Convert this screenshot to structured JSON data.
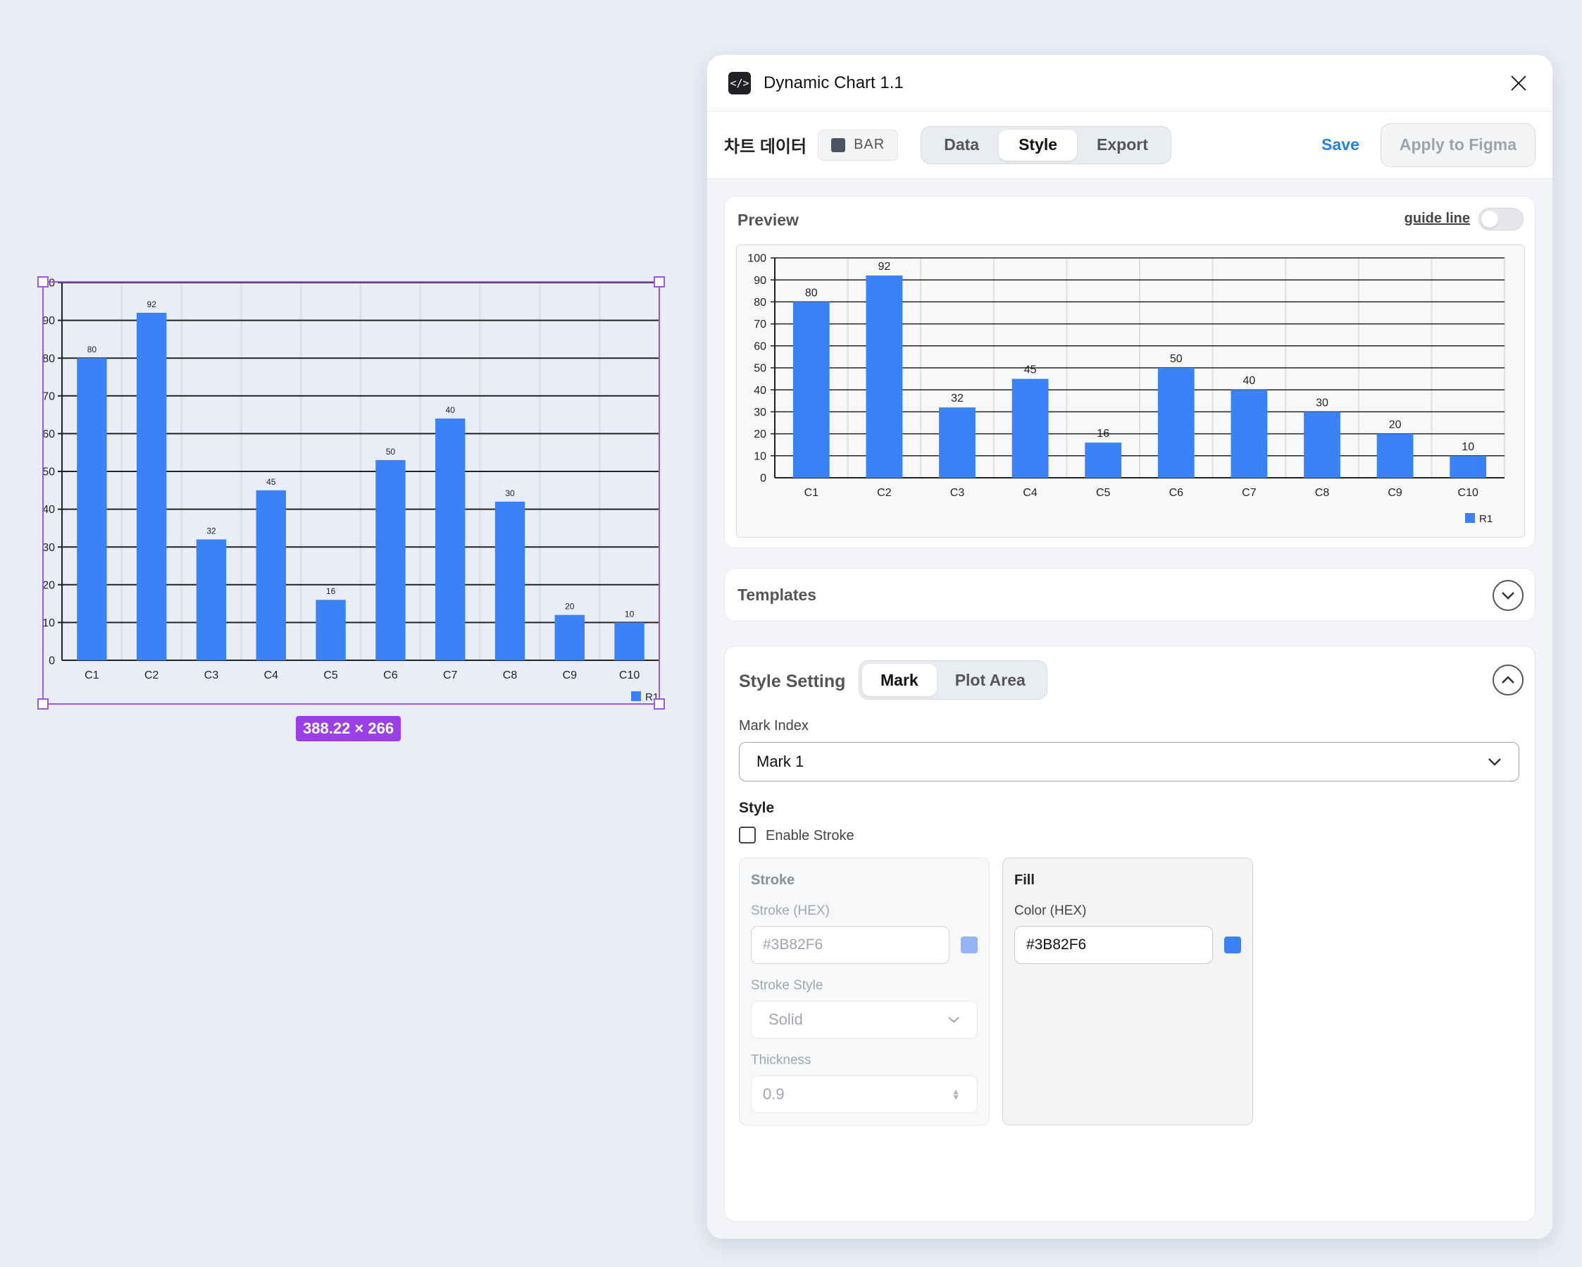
{
  "canvas": {
    "dimension_badge": "388.22 × 266",
    "y_ticks": [
      "0",
      "10",
      "20",
      "30",
      "40",
      "50",
      "60",
      "70",
      "80",
      "90",
      "0"
    ]
  },
  "plugin": {
    "title": "Dynamic Chart 1.1",
    "app_icon": "code-icon",
    "toolbar": {
      "chart_data_label": "차트 데이터",
      "chart_type": "BAR",
      "tabs": [
        {
          "label": "Data"
        },
        {
          "label": "Style"
        },
        {
          "label": "Export"
        }
      ],
      "active_tab": "Style",
      "save_label": "Save",
      "apply_label": "Apply to Figma"
    },
    "preview": {
      "title": "Preview",
      "guide_line_label": "guide line",
      "guide_line_on": false,
      "y_ticks": [
        "0",
        "10",
        "20",
        "30",
        "40",
        "50",
        "60",
        "70",
        "80",
        "90",
        "100"
      ]
    },
    "templates": {
      "title": "Templates"
    },
    "style_setting": {
      "title": "Style Setting",
      "tabs": [
        {
          "label": "Mark"
        },
        {
          "label": "Plot Area"
        }
      ],
      "active_tab": "Mark",
      "mark_index_label": "Mark Index",
      "mark_index_value": "Mark 1",
      "style_heading": "Style",
      "enable_stroke_label": "Enable Stroke",
      "enable_stroke_checked": false,
      "stroke": {
        "title": "Stroke",
        "hex_label": "Stroke (HEX)",
        "hex_value": "#3B82F6",
        "swatch_color": "#93B4F5",
        "style_label": "Stroke Style",
        "style_value": "Solid",
        "thickness_label": "Thickness",
        "thickness_value": "0.9"
      },
      "fill": {
        "title": "Fill",
        "hex_label": "Color (HEX)",
        "hex_value": "#3B82F6",
        "swatch_color": "#3B82F6"
      }
    }
  },
  "chart_data": [
    {
      "type": "bar",
      "categories": [
        "C1",
        "C2",
        "C3",
        "C4",
        "C5",
        "C6",
        "C7",
        "C8",
        "C9",
        "C10"
      ],
      "series": [
        {
          "name": "R1",
          "values": [
            80,
            92,
            32,
            45,
            16,
            50,
            40,
            30,
            20,
            10
          ],
          "heights": [
            80,
            92,
            32,
            45,
            16,
            53,
            64,
            42,
            12,
            10
          ],
          "color": "#3B82F6"
        }
      ],
      "ylim": [
        0,
        100
      ],
      "grid": true,
      "legend": "bottom-right"
    },
    {
      "type": "bar",
      "categories": [
        "C1",
        "C2",
        "C3",
        "C4",
        "C5",
        "C6",
        "C7",
        "C8",
        "C9",
        "C10"
      ],
      "series": [
        {
          "name": "R1",
          "values": [
            80,
            92,
            32,
            45,
            16,
            50,
            40,
            30,
            20,
            10
          ],
          "color": "#3B82F6"
        }
      ],
      "ylim": [
        0,
        100
      ],
      "grid": true,
      "legend": "bottom-right"
    }
  ]
}
